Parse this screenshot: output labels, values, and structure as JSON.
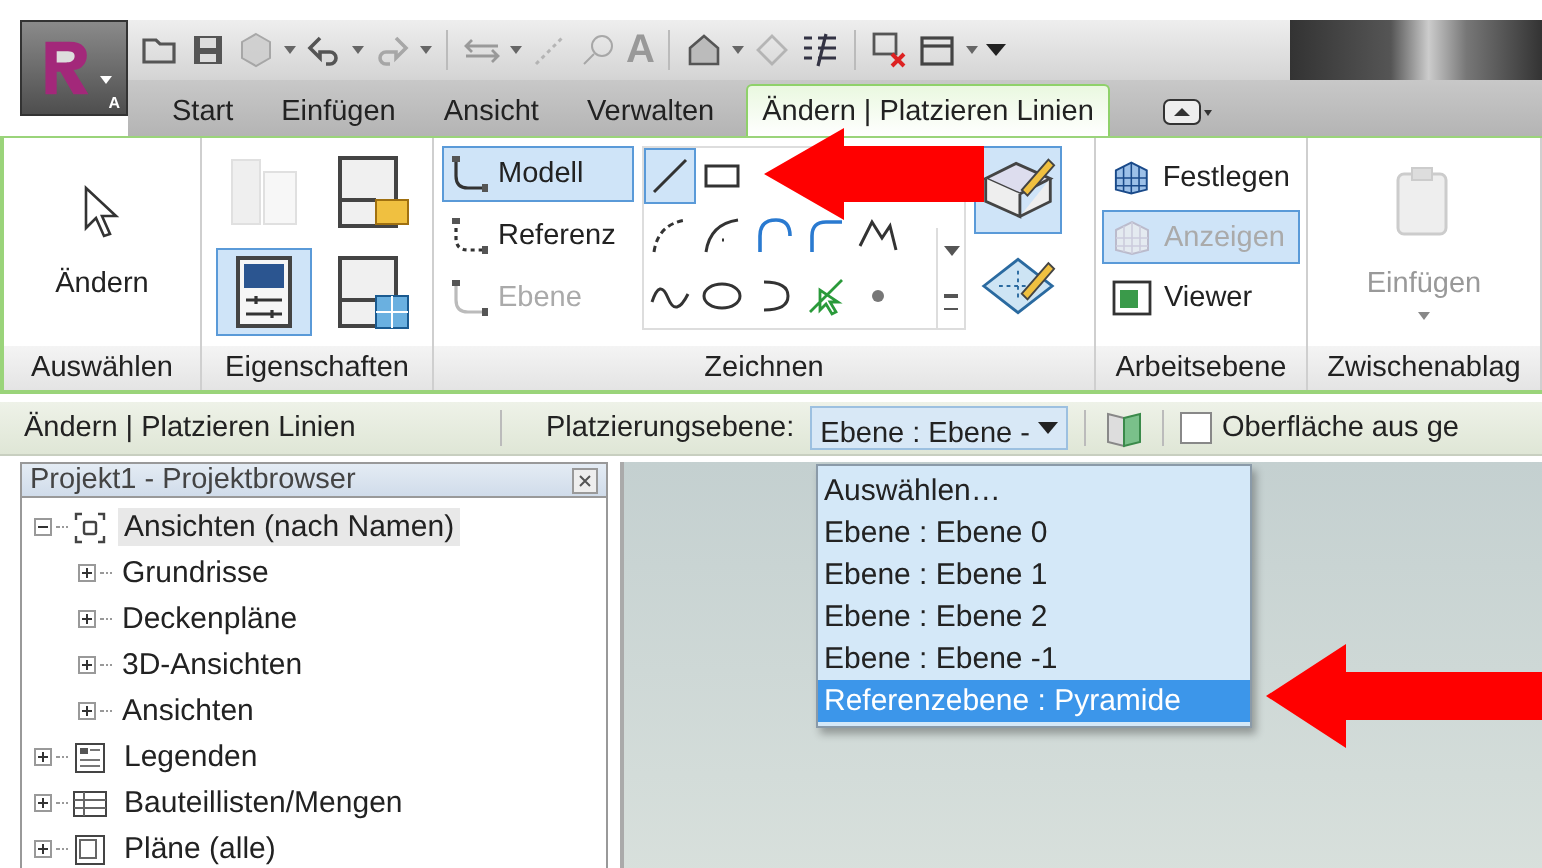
{
  "app_button": {
    "badge": "A"
  },
  "quick_access": {
    "text_glyph": "A"
  },
  "tabs": [
    {
      "label": "Start",
      "selected": false
    },
    {
      "label": "Einfügen",
      "selected": false
    },
    {
      "label": "Ansicht",
      "selected": false
    },
    {
      "label": "Verwalten",
      "selected": false
    },
    {
      "label": "Ändern | Platzieren Linien",
      "selected": true
    }
  ],
  "ribbon": {
    "select_panel": {
      "label": "Auswählen",
      "tool": "Ändern"
    },
    "properties_panel": {
      "label": "Eigenschaften",
      "tools": [
        {
          "kind": "type",
          "selected": false,
          "disabled": true
        },
        {
          "kind": "family",
          "selected": false,
          "disabled": false
        },
        {
          "kind": "properties",
          "selected": true,
          "disabled": false
        },
        {
          "kind": "types",
          "selected": false,
          "disabled": false
        }
      ]
    },
    "draw_panel": {
      "label": "Zeichnen",
      "modes": [
        {
          "label": "Modell",
          "selected": true,
          "disabled": false
        },
        {
          "label": "Referenz",
          "selected": false,
          "disabled": false
        },
        {
          "label": "Ebene",
          "selected": false,
          "disabled": true
        }
      ],
      "shapes": [
        {
          "kind": "line",
          "selected": true
        },
        {
          "kind": "rectangle",
          "selected": false
        },
        {
          "kind": "arc",
          "selected": false
        },
        {
          "kind": "arc-center",
          "selected": false
        },
        {
          "kind": "arc-tangent",
          "selected": false
        },
        {
          "kind": "fillet",
          "selected": false
        },
        {
          "kind": "spline",
          "selected": false
        },
        {
          "kind": "wave",
          "selected": false
        },
        {
          "kind": "ellipse",
          "selected": false
        },
        {
          "kind": "half-ellipse",
          "selected": false
        },
        {
          "kind": "pick",
          "selected": false
        },
        {
          "kind": "point",
          "selected": false
        }
      ],
      "large_tools": [
        {
          "kind": "plane",
          "selected": true
        },
        {
          "kind": "pick-plane",
          "selected": false
        }
      ]
    },
    "workplane_panel": {
      "label": "Arbeitsebene",
      "buttons": [
        {
          "kind": "grid",
          "label": "Festlegen",
          "selected": false,
          "disabled": false
        },
        {
          "kind": "grid",
          "label": "Anzeigen",
          "selected": true,
          "disabled": true
        },
        {
          "kind": "viewer",
          "label": "Viewer",
          "selected": false,
          "disabled": false
        }
      ]
    },
    "clipboard_panel": {
      "label": "Zwischenablag",
      "paste": {
        "label": "Einfügen",
        "disabled": true
      }
    }
  },
  "options_bar": {
    "context": "Ändern | Platzieren Linien",
    "placement_label": "Platzierungsebene:",
    "placement_value": "Ebene : Ebene -",
    "checkbox": {
      "label": "Oberfläche aus ge",
      "checked": false
    }
  },
  "dropdown_options": [
    {
      "label": "Auswählen…",
      "selected": false
    },
    {
      "label": "Ebene : Ebene 0",
      "selected": false
    },
    {
      "label": "Ebene : Ebene 1",
      "selected": false
    },
    {
      "label": "Ebene : Ebene 2",
      "selected": false
    },
    {
      "label": "Ebene : Ebene -1",
      "selected": false
    },
    {
      "label": "Referenzebene : Pyramide",
      "selected": true
    }
  ],
  "project_browser": {
    "title": "Projekt1 - Projektbrowser",
    "tree": [
      {
        "kind": "views",
        "label": "Ansichten (nach Namen)",
        "expanded": true,
        "selected": true,
        "children": [
          {
            "label": "Grundrisse",
            "expanded": false
          },
          {
            "label": "Deckenpläne",
            "expanded": false
          },
          {
            "label": "3D-Ansichten",
            "expanded": false
          },
          {
            "label": "Ansichten",
            "expanded": false
          }
        ]
      },
      {
        "kind": "legend",
        "label": "Legenden",
        "expanded": false,
        "selected": false
      },
      {
        "kind": "schedule",
        "label": "Bauteillisten/Mengen",
        "expanded": false,
        "selected": false
      },
      {
        "kind": "sheets",
        "label": "Pläne (alle)",
        "expanded": false,
        "selected": false
      }
    ]
  }
}
